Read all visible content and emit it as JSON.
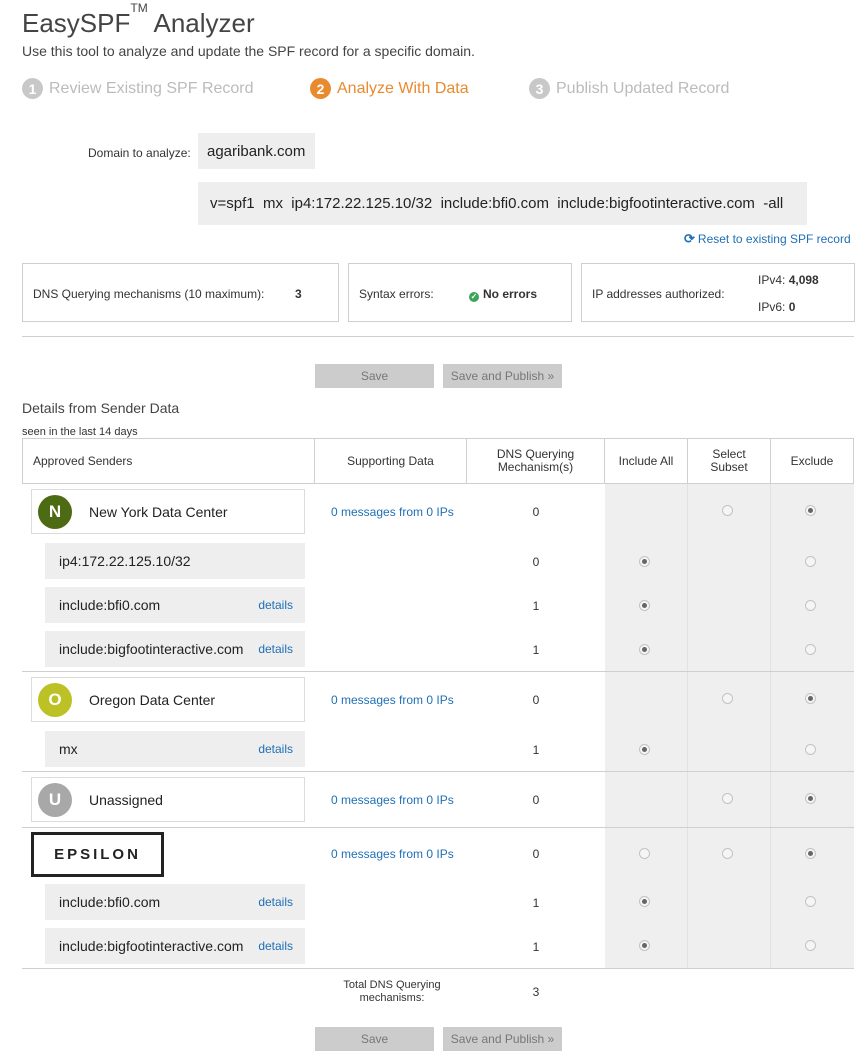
{
  "header": {
    "title": "EasySPF",
    "title_tm": "TM",
    "title_suffix": " Analyzer",
    "subtitle": "Use this tool to analyze and update the SPF record for a specific domain."
  },
  "steps": [
    {
      "num": "1",
      "label": "Review Existing SPF Record",
      "state": "inactive"
    },
    {
      "num": "2",
      "label": "Analyze With Data",
      "state": "active"
    },
    {
      "num": "3",
      "label": "Publish Updated Record",
      "state": "inactive"
    }
  ],
  "domain": {
    "label": "Domain to analyze:",
    "value": "agaribank.com"
  },
  "spf_record": "v=spf1  mx  ip4:172.22.125.10/32  include:bfi0.com  include:bigfootinteractive.com  -all",
  "reset_link": "Reset to existing SPF record",
  "stats": {
    "dns_label": "DNS Querying mechanisms (10 maximum):",
    "dns_value": "3",
    "syntax_label": "Syntax errors:",
    "syntax_value": "No errors",
    "ip_label": "IP addresses authorized:",
    "ipv4_label": "IPv4:",
    "ipv4_value": "4,098",
    "ipv6_label": "IPv6:",
    "ipv6_value": "0"
  },
  "buttons": {
    "save": "Save",
    "save_publish": "Save and Publish »"
  },
  "details": {
    "title": "Details from Sender Data",
    "seen": "seen in the last 14 days"
  },
  "table_headers": {
    "approved": "Approved Senders",
    "supporting": "Supporting Data",
    "dns": "DNS Querying Mechanism(s)",
    "include_all": "Include All",
    "select_subset": "Select Subset",
    "exclude": "Exclude"
  },
  "senders": {
    "ny": {
      "initial": "N",
      "name": "New York Data Center",
      "messages": "0 messages from 0 IPs",
      "count": "0",
      "color": "#4d6b12"
    },
    "oregon": {
      "initial": "O",
      "name": "Oregon Data Center",
      "messages": "0 messages from 0 IPs",
      "count": "0",
      "color": "#bcc225"
    },
    "unassigned": {
      "initial": "U",
      "name": "Unassigned",
      "messages": "0 messages from 0 IPs",
      "count": "0",
      "color": "#a8a8a8"
    },
    "epsilon": {
      "logo_text": "EPSILON",
      "messages": "0 messages from 0 IPs",
      "count": "0"
    }
  },
  "mechanisms": {
    "ny1": {
      "name": "ip4:172.22.125.10/32",
      "details": "",
      "count": "0"
    },
    "ny2": {
      "name": "include:bfi0.com",
      "details": "details",
      "count": "1"
    },
    "ny3": {
      "name": "include:bigfootinteractive.com",
      "details": "details",
      "count": "1"
    },
    "or1": {
      "name": "mx",
      "details": "details",
      "count": "1"
    },
    "ep1": {
      "name": "include:bfi0.com",
      "details": "details",
      "count": "1"
    },
    "ep2": {
      "name": "include:bigfootinteractive.com",
      "details": "details",
      "count": "1"
    }
  },
  "total": {
    "label": "Total DNS Querying mechanisms:",
    "value": "3"
  }
}
